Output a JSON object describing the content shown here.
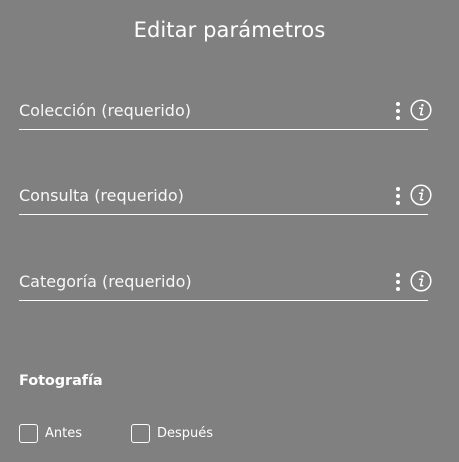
{
  "dialog": {
    "title": "Editar parámetros"
  },
  "fields": [
    {
      "placeholder": "Colección (requerido)",
      "value": ""
    },
    {
      "placeholder": "Consulta (requerido)",
      "value": ""
    },
    {
      "placeholder": "Categoría (requerido)",
      "value": ""
    }
  ],
  "photo_section": {
    "title": "Fotografía",
    "options": [
      {
        "label": "Antes",
        "checked": false
      },
      {
        "label": "Después",
        "checked": false
      }
    ]
  },
  "colors": {
    "background": "#808080",
    "text": "#ffffff"
  },
  "icons": {
    "menu": "more-vertical-icon",
    "info": "info-icon"
  }
}
